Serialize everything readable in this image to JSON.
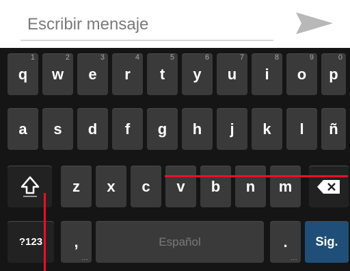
{
  "composer": {
    "placeholder": "Escribir mensaje",
    "send_icon": "send-icon"
  },
  "keyboard": {
    "row1": [
      {
        "label": "q",
        "hint": "1"
      },
      {
        "label": "w",
        "hint": "2"
      },
      {
        "label": "e",
        "hint": "3"
      },
      {
        "label": "r",
        "hint": "4"
      },
      {
        "label": "t",
        "hint": "5"
      },
      {
        "label": "y",
        "hint": "6"
      },
      {
        "label": "u",
        "hint": "7"
      },
      {
        "label": "i",
        "hint": "8"
      },
      {
        "label": "o",
        "hint": "9"
      },
      {
        "label": "p",
        "hint": "0"
      }
    ],
    "row2": [
      "a",
      "s",
      "d",
      "f",
      "g",
      "h",
      "j",
      "k",
      "l",
      "ñ"
    ],
    "row3": [
      "z",
      "x",
      "c",
      "v",
      "b",
      "n",
      "m"
    ],
    "shift_icon": "shift-icon",
    "backspace_icon": "backspace-icon",
    "symbols_label": "?123",
    "comma_label": ",",
    "space_label": "Español",
    "period_label": ".",
    "enter_label": "Sig.",
    "more_mark": "…"
  },
  "colors": {
    "annotation": "#e8102a",
    "enter_key": "#1f4f78",
    "key": "#3a3a3a"
  }
}
